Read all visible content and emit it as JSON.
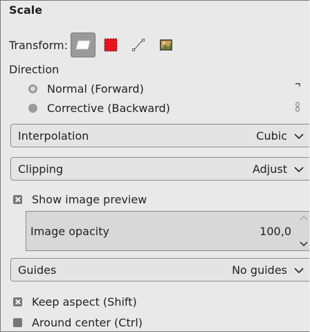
{
  "title": "Scale",
  "transform": {
    "label": "Transform:",
    "buttons": [
      {
        "name": "layer",
        "icon": "transform-layer-icon",
        "active": true
      },
      {
        "name": "selection",
        "icon": "transform-selection-icon",
        "active": false
      },
      {
        "name": "path",
        "icon": "transform-path-icon",
        "active": false
      },
      {
        "name": "image",
        "icon": "transform-image-icon",
        "active": false
      }
    ]
  },
  "direction": {
    "label": "Direction",
    "options": [
      {
        "label": "Normal (Forward)",
        "selected": true
      },
      {
        "label": "Corrective (Backward)",
        "selected": false
      }
    ]
  },
  "interpolation": {
    "label": "Interpolation",
    "value": "Cubic"
  },
  "clipping": {
    "label": "Clipping",
    "value": "Adjust"
  },
  "show_preview": {
    "label": "Show image preview",
    "checked": true
  },
  "opacity": {
    "label": "Image opacity",
    "value": "100,0"
  },
  "guides": {
    "label": "Guides",
    "value": "No guides"
  },
  "keep_aspect": {
    "label": "Keep aspect (Shift)",
    "checked": true
  },
  "around_center": {
    "label": "Around center (Ctrl)",
    "checked": false
  },
  "colors": {
    "selection_red": "#e8141b",
    "accent_gray": "#9a9a9a"
  }
}
